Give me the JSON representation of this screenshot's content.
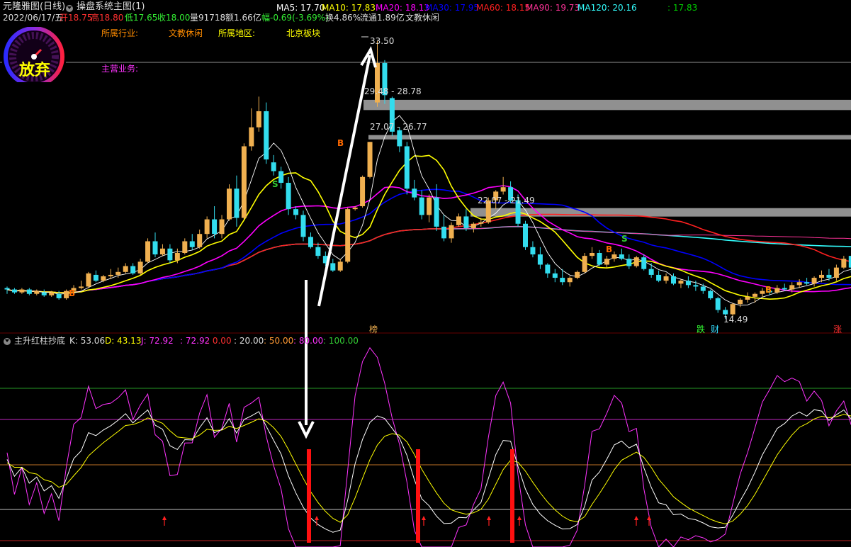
{
  "header": {
    "app_title": "元隆雅图(日线)",
    "menu_label": "操盘系统主图(1)",
    "ma": [
      {
        "label": "MA5: 17.70",
        "color": "#ffffff"
      },
      {
        "label": "MA10: 17.83",
        "color": "#ffff00"
      },
      {
        "label": "MA20: 18.13",
        "color": "#ff00ff"
      },
      {
        "label": "MA30: 17.95",
        "color": "#0000ff"
      },
      {
        "label": "MA60: 18.15",
        "color": "#ff2020"
      },
      {
        "label": "MA90: 19.73",
        "color": "#ff3399"
      },
      {
        "label": "MA120: 20.16",
        "color": "#33ffff"
      },
      {
        "label": ": 17.83",
        "color": "#00cc00"
      }
    ],
    "quote": {
      "date": "2022/06/17/五",
      "open_label": "开",
      "open": "18.75",
      "high_label": "高",
      "high": "18.80",
      "low_label": "低",
      "low": "17.65",
      "close_label": "收",
      "close": "18.00",
      "volume_label": "量",
      "volume": "91718",
      "amount_label": "额",
      "amount": "1.66亿",
      "change_label": "幅",
      "change": "-0.69(-3.69%)",
      "turnover_label": "换",
      "turnover": "4.86%",
      "float_label": "流通",
      "float": "1.89亿",
      "sector_tag": "文教休闲"
    }
  },
  "info": {
    "industry_label": "所属行业:",
    "industry_value": "文教休闲",
    "region_label": "所属地区:",
    "region_value": "北京板块",
    "business_label": "主营业务:"
  },
  "gauge": {
    "text": "放弃"
  },
  "annotations": {
    "high_price": "33.50",
    "zone1": "29.48 - 28.78",
    "zone2": "27.07 - 26.77",
    "zone3": "22.07 - 21.49",
    "low_price": "14.49",
    "bang": "榜",
    "die": "跌",
    "cai": "财",
    "zhang": "涨",
    "sig_b": "B",
    "sig_s": "S"
  },
  "indicator": {
    "name": "主升红柱抄底",
    "k": "K: 53.06",
    "d": "D: 43.13",
    "j": "J: 72.92",
    "j2": ": 72.92",
    "l0": ": 0.00",
    "l20": ": 20.00",
    "l50": ": 50.00",
    "l80": ": 80.00",
    "l100": ": 100.00"
  },
  "colors": {
    "up": "#f0b050",
    "down": "#33ddee",
    "ma5": "#ffffff",
    "ma10": "#ffff00",
    "ma20": "#ff00ff",
    "ma30": "#0000ff",
    "ma60": "#ff2020",
    "ma90": "#ff3399",
    "ma120": "#33ffff",
    "ma_green": "#00cc00"
  },
  "chart_data": {
    "type": "candlestick",
    "price_range": [
      14.49,
      33.5
    ],
    "candles": [
      [
        16.6,
        16.7,
        16.2,
        16.5
      ],
      [
        16.5,
        16.6,
        16.2,
        16.3
      ],
      [
        16.3,
        16.6,
        16.2,
        16.5
      ],
      [
        16.5,
        16.6,
        16.1,
        16.2
      ],
      [
        16.2,
        16.5,
        16.1,
        16.4
      ],
      [
        16.3,
        16.5,
        16.0,
        16.1
      ],
      [
        16.1,
        16.4,
        16.0,
        16.3
      ],
      [
        16.2,
        16.4,
        15.8,
        15.9
      ],
      [
        15.9,
        16.5,
        15.8,
        16.4
      ],
      [
        16.4,
        16.8,
        16.3,
        16.6
      ],
      [
        16.6,
        17.1,
        16.5,
        16.7
      ],
      [
        16.7,
        17.7,
        16.6,
        17.6
      ],
      [
        17.5,
        17.8,
        17.0,
        17.1
      ],
      [
        17.1,
        17.5,
        17.0,
        17.4
      ],
      [
        17.4,
        17.9,
        17.2,
        17.5
      ],
      [
        17.5,
        18.0,
        17.3,
        17.7
      ],
      [
        17.7,
        18.3,
        17.6,
        18.1
      ],
      [
        18.1,
        18.3,
        17.5,
        17.6
      ],
      [
        17.6,
        18.6,
        17.5,
        18.4
      ],
      [
        18.4,
        20.0,
        18.3,
        19.8
      ],
      [
        19.8,
        20.4,
        18.7,
        18.9
      ],
      [
        18.9,
        19.6,
        18.8,
        19.3
      ],
      [
        19.3,
        19.6,
        18.3,
        18.5
      ],
      [
        18.5,
        19.3,
        18.3,
        19.0
      ],
      [
        19.0,
        20.0,
        18.9,
        19.8
      ],
      [
        19.8,
        20.3,
        19.2,
        19.4
      ],
      [
        19.4,
        20.6,
        19.3,
        20.3
      ],
      [
        20.3,
        21.5,
        20.0,
        21.3
      ],
      [
        21.3,
        22.2,
        20.0,
        20.3
      ],
      [
        20.3,
        21.6,
        20.0,
        21.3
      ],
      [
        21.3,
        23.7,
        21.2,
        23.4
      ],
      [
        23.4,
        24.3,
        20.8,
        21.4
      ],
      [
        21.4,
        26.5,
        21.3,
        26.3
      ],
      [
        26.3,
        28.9,
        26.0,
        27.6
      ],
      [
        27.6,
        29.7,
        27.3,
        28.7
      ],
      [
        28.7,
        29.3,
        25.1,
        25.4
      ],
      [
        25.2,
        25.7,
        24.3,
        24.6
      ],
      [
        24.6,
        24.9,
        23.4,
        23.8
      ],
      [
        23.8,
        24.2,
        21.6,
        22.0
      ],
      [
        22.0,
        22.2,
        21.3,
        21.6
      ],
      [
        21.6,
        21.9,
        19.8,
        20.1
      ],
      [
        20.1,
        20.4,
        19.3,
        19.4
      ],
      [
        19.4,
        19.7,
        18.6,
        18.8
      ],
      [
        18.8,
        19.1,
        18.1,
        18.3
      ],
      [
        18.3,
        18.6,
        17.7,
        17.8
      ],
      [
        17.8,
        18.6,
        17.7,
        18.4
      ],
      [
        18.4,
        22.1,
        18.3,
        22.0
      ],
      [
        22.0,
        22.2,
        21.9,
        22.1
      ],
      [
        22.2,
        24.3,
        22.1,
        24.2
      ],
      [
        24.2,
        26.6,
        24.1,
        26.6
      ],
      [
        29.3,
        33.5,
        29.0,
        32.0
      ],
      [
        32.0,
        32.2,
        29.2,
        29.8
      ],
      [
        29.6,
        29.7,
        27.0,
        27.3
      ],
      [
        27.4,
        27.6,
        25.9,
        26.3
      ],
      [
        26.3,
        26.6,
        23.0,
        23.4
      ],
      [
        23.4,
        24.0,
        22.6,
        22.8
      ],
      [
        22.8,
        23.3,
        21.3,
        21.6
      ],
      [
        21.6,
        23.0,
        21.1,
        22.8
      ],
      [
        22.8,
        23.7,
        20.5,
        20.8
      ],
      [
        20.8,
        21.6,
        19.8,
        20.0
      ],
      [
        20.0,
        21.1,
        19.7,
        20.9
      ],
      [
        20.9,
        21.7,
        20.8,
        21.5
      ],
      [
        21.5,
        22.0,
        20.5,
        20.7
      ],
      [
        20.7,
        21.1,
        20.4,
        21.0
      ],
      [
        21.0,
        21.4,
        20.8,
        21.1
      ],
      [
        21.1,
        22.8,
        21.0,
        22.6
      ],
      [
        22.6,
        23.3,
        22.0,
        23.2
      ],
      [
        23.2,
        24.2,
        23.0,
        23.5
      ],
      [
        23.5,
        23.9,
        22.4,
        22.6
      ],
      [
        22.6,
        23.0,
        20.8,
        21.0
      ],
      [
        21.0,
        21.2,
        19.2,
        19.4
      ],
      [
        19.4,
        19.8,
        18.7,
        18.9
      ],
      [
        18.9,
        19.4,
        17.9,
        18.2
      ],
      [
        18.2,
        18.3,
        17.3,
        17.6
      ],
      [
        17.6,
        17.9,
        17.0,
        17.3
      ],
      [
        17.3,
        17.9,
        16.8,
        17.0
      ],
      [
        17.0,
        17.4,
        16.7,
        17.3
      ],
      [
        17.3,
        17.8,
        17.2,
        17.7
      ],
      [
        17.7,
        19.0,
        17.6,
        18.8
      ],
      [
        18.8,
        19.4,
        18.6,
        19.0
      ],
      [
        19.0,
        19.2,
        18.1,
        18.2
      ],
      [
        18.2,
        18.8,
        18.0,
        18.6
      ],
      [
        18.6,
        19.1,
        18.4,
        18.9
      ],
      [
        18.9,
        19.3,
        18.5,
        18.6
      ],
      [
        18.6,
        18.9,
        17.9,
        18.1
      ],
      [
        18.1,
        18.8,
        18.0,
        18.7
      ],
      [
        18.7,
        18.9,
        17.8,
        17.9
      ],
      [
        17.9,
        18.3,
        17.3,
        17.5
      ],
      [
        17.5,
        17.8,
        17.0,
        17.1
      ],
      [
        17.1,
        17.6,
        16.9,
        17.4
      ],
      [
        17.4,
        17.6,
        16.8,
        16.9
      ],
      [
        16.9,
        17.2,
        16.6,
        17.1
      ],
      [
        17.1,
        17.4,
        16.6,
        16.8
      ],
      [
        16.8,
        17.1,
        16.4,
        16.7
      ],
      [
        16.7,
        16.9,
        16.2,
        16.4
      ],
      [
        16.4,
        16.5,
        15.8,
        15.9
      ],
      [
        15.9,
        16.0,
        14.9,
        15.1
      ],
      [
        15.1,
        15.3,
        14.5,
        14.8
      ],
      [
        14.8,
        15.6,
        14.6,
        15.5
      ],
      [
        15.5,
        15.9,
        15.3,
        15.8
      ],
      [
        15.8,
        16.3,
        15.6,
        16.0
      ],
      [
        16.0,
        16.3,
        15.6,
        16.2
      ],
      [
        16.2,
        16.6,
        16.0,
        16.4
      ],
      [
        16.4,
        16.7,
        16.1,
        16.3
      ],
      [
        16.3,
        16.8,
        16.2,
        16.6
      ],
      [
        16.6,
        16.9,
        16.4,
        16.5
      ],
      [
        16.5,
        17.0,
        16.3,
        16.8
      ],
      [
        16.8,
        17.2,
        16.6,
        17.0
      ],
      [
        17.0,
        17.3,
        16.8,
        16.9
      ],
      [
        16.9,
        17.4,
        16.7,
        17.3
      ],
      [
        17.3,
        17.8,
        17.0,
        17.5
      ],
      [
        17.5,
        17.9,
        17.1,
        17.3
      ],
      [
        17.3,
        18.2,
        17.1,
        18.0
      ],
      [
        18.0,
        18.8,
        17.9,
        18.6
      ],
      [
        18.8,
        18.8,
        17.65,
        18.0
      ]
    ],
    "zones": [
      [
        29.48,
        28.78
      ],
      [
        27.07,
        26.77
      ],
      [
        22.07,
        21.49
      ]
    ],
    "indicator_levels": [
      0,
      20,
      50,
      80,
      100
    ]
  }
}
